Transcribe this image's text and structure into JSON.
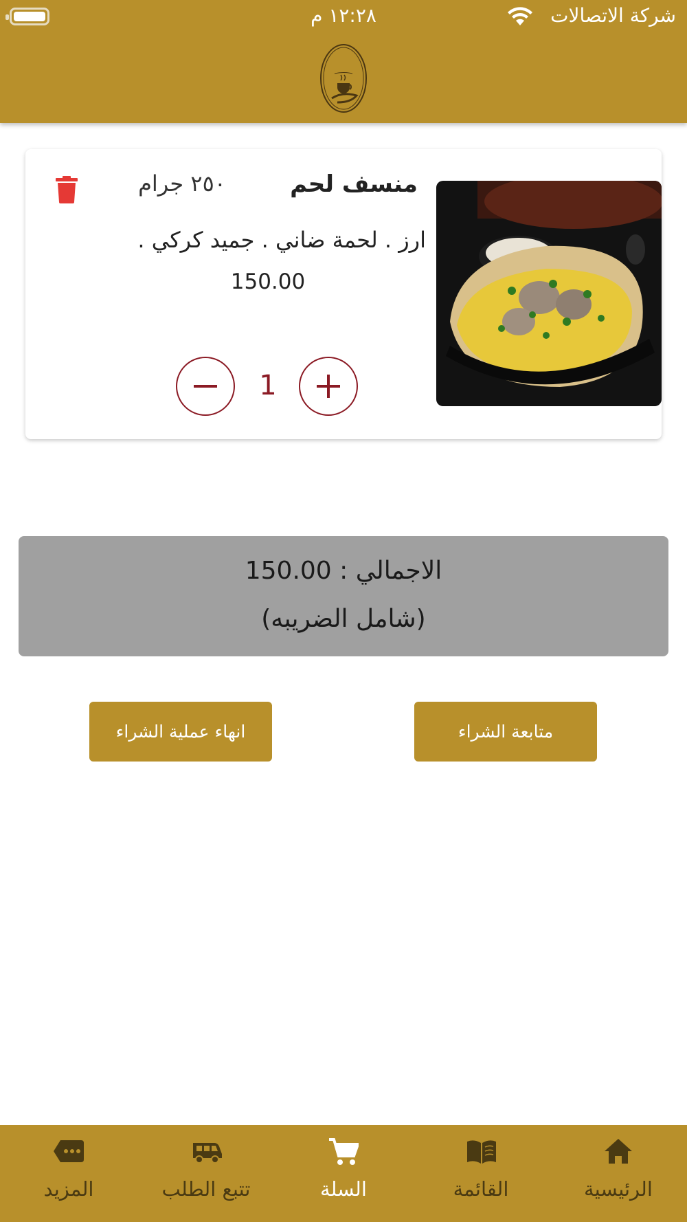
{
  "status_bar": {
    "carrier": "شركة الاتصالات",
    "time": "١٢:٢٨ م"
  },
  "colors": {
    "brand": "#b8902b",
    "accent": "#8b1a24",
    "delete": "#e53935",
    "total_background": "#a0a0a0"
  },
  "cart": {
    "items": [
      {
        "title": "منسف لحم",
        "weight": "٢٥٠ جرام",
        "description": "ارز . لحمة ضاني . جميد كركي .",
        "price": "150.00",
        "quantity": "1"
      }
    ]
  },
  "summary": {
    "total_line": "الاجمالي : 150.00",
    "tax_note": "(شامل الضريبه)"
  },
  "actions": {
    "finish_label": "انهاء عملية الشراء",
    "continue_label": "متابعة الشراء"
  },
  "bottom_nav": {
    "items": [
      {
        "label": "الرئيسية",
        "icon": "home-icon",
        "active": false
      },
      {
        "label": "القائمة",
        "icon": "menu-book-icon",
        "active": false
      },
      {
        "label": "السلة",
        "icon": "cart-icon",
        "active": true
      },
      {
        "label": "تتبع الطلب",
        "icon": "truck-icon",
        "active": false
      },
      {
        "label": "المزيد",
        "icon": "more-icon",
        "active": false
      }
    ]
  }
}
